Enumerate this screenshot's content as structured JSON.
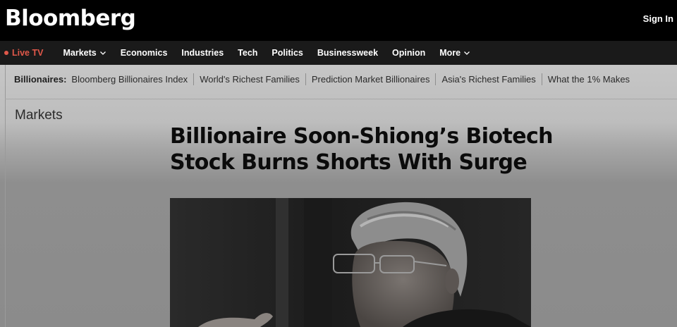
{
  "header": {
    "logo": "Bloomberg",
    "sign_in": "Sign In"
  },
  "nav": {
    "live_tv": "Live TV",
    "items": [
      {
        "label": "Markets",
        "dropdown": true
      },
      {
        "label": "Economics",
        "dropdown": false
      },
      {
        "label": "Industries",
        "dropdown": false
      },
      {
        "label": "Tech",
        "dropdown": false
      },
      {
        "label": "Politics",
        "dropdown": false
      },
      {
        "label": "Businessweek",
        "dropdown": false
      },
      {
        "label": "Opinion",
        "dropdown": false
      },
      {
        "label": "More",
        "dropdown": true
      }
    ]
  },
  "subnav": {
    "heading": "Billionaires:",
    "links": [
      "Bloomberg Billionaires Index",
      "World's Richest Families",
      "Prediction Market Billionaires",
      "Asia's Richest Families",
      "What the 1% Makes"
    ]
  },
  "article": {
    "section": "Markets",
    "headline": "Billionaire Soon-Shiong’s Biotech Stock Burns Shorts With Surge"
  },
  "colors": {
    "live_red": "#e0584a",
    "topbar": "#000000",
    "navbar": "#1a1a1a"
  }
}
